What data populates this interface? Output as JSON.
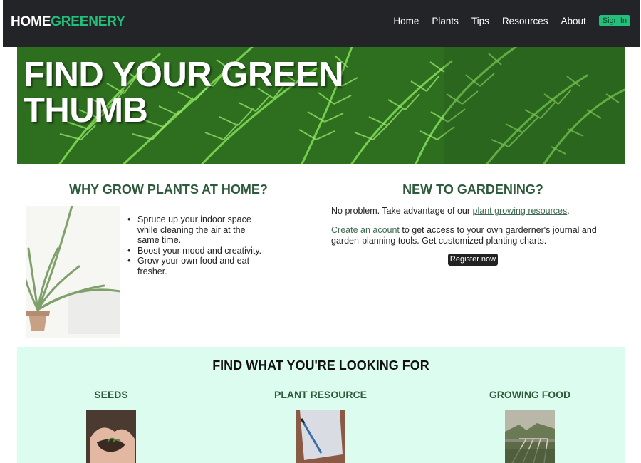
{
  "brand": {
    "part1": "HOME",
    "part2": "GREENERY"
  },
  "nav": {
    "links": [
      "Home",
      "Plants",
      "Tips",
      "Resources",
      "About"
    ],
    "signin_label": "Sign In"
  },
  "hero": {
    "title": "FIND YOUR GREEN THUMB"
  },
  "why": {
    "title": "WHY GROW PLANTS AT HOME?",
    "benefits": [
      "Spruce up your indoor space while cleaning the air at the same time.",
      "Boost your mood and creativity.",
      "Grow your own food and eat fresher."
    ]
  },
  "new_gardening": {
    "title": "NEW TO GARDENING?",
    "p1_prefix": "No problem. Take advantage of our ",
    "p1_link": "plant growing resources",
    "p1_suffix": ".",
    "p2_link": "Create an acount",
    "p2_text": " to get access to your own garderner's journal and garden-planning tools. Get customized planting charts.",
    "register_label": "Register now"
  },
  "find": {
    "title": "FIND WHAT YOU'RE LOOKING FOR",
    "categories": [
      "SEEDS",
      "PLANT RESOURCE",
      "GROWING FOOD"
    ]
  },
  "colors": {
    "nav_bg": "#232427",
    "brand_green": "#22c07a",
    "heading_green": "#2d5a3a",
    "find_bg": "#dcfcef"
  }
}
